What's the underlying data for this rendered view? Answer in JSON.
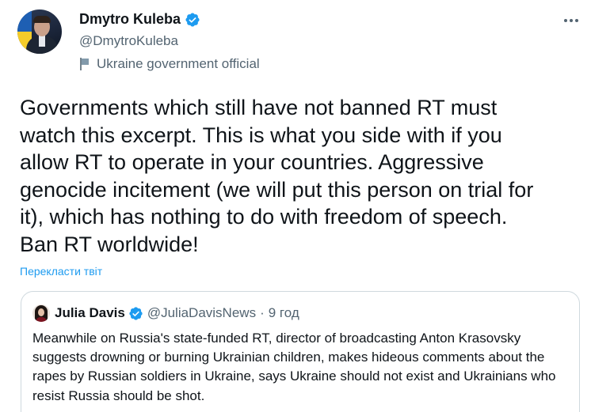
{
  "author": {
    "name": "Dmytro Kuleba",
    "handle": "@DmytroKuleba",
    "label": "Ukraine government official"
  },
  "tweet": {
    "text": "Governments which still have not banned RT must\nwatch this excerpt. This is what you side with if you\nallow RT to operate in your countries. Aggressive\ngenocide incitement (we will put this person on trial for\nit), which has nothing to do with freedom of speech.\nBan RT worldwide!",
    "translate_label": "Перекласти твіт"
  },
  "quoted": {
    "name": "Julia Davis",
    "handle": "@JuliaDavisNews",
    "separator": "·",
    "time": "9 год",
    "text": "Meanwhile on Russia's state-funded RT, director of broadcasting Anton Krasovsky suggests drowning or burning Ukrainian children, makes hideous comments about the rapes by Russian soldiers in Ukraine, says Ukraine should not exist and Ukrainians who resist Russia should be shot."
  },
  "icons": {
    "verified": "verified-badge-icon",
    "government": "flag-icon",
    "more": "more-icon"
  },
  "colors": {
    "verified": "#1d9bf0",
    "link": "#1d9bf0",
    "secondary_text": "#536471",
    "primary_text": "#0f1419",
    "border": "#cfd9de"
  }
}
